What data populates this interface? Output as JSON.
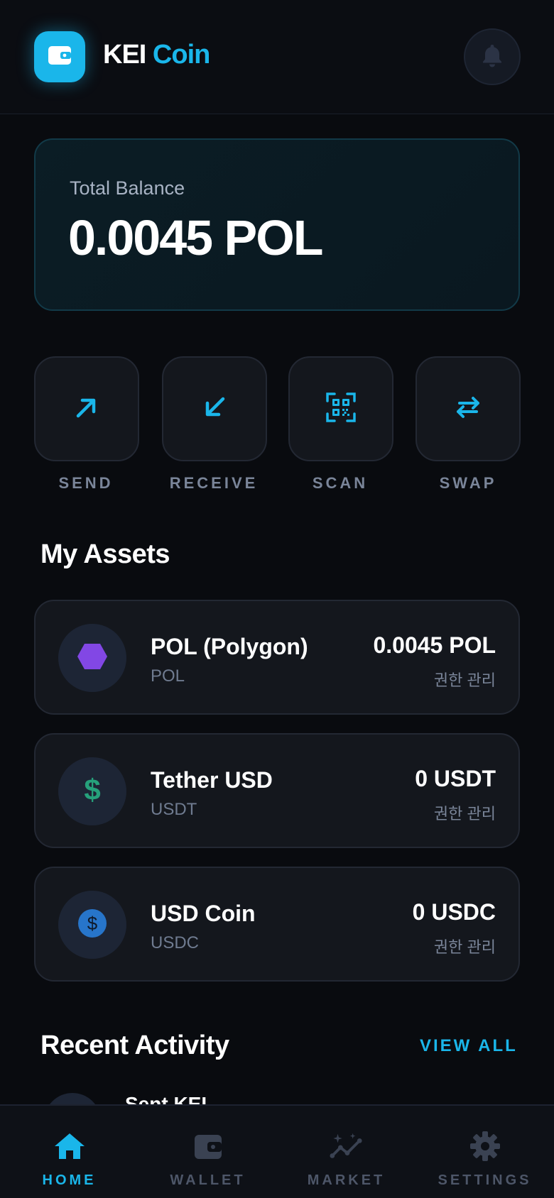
{
  "header": {
    "brand_primary": "KEI",
    "brand_accent": "Coin",
    "logo_icon": "wallet-icon",
    "notification_icon": "bell-icon"
  },
  "balance": {
    "label": "Total Balance",
    "value": "0.0045 POL"
  },
  "actions": [
    {
      "label": "SEND",
      "icon": "arrow-up-right-icon"
    },
    {
      "label": "RECEIVE",
      "icon": "arrow-down-left-icon"
    },
    {
      "label": "SCAN",
      "icon": "qr-scan-icon"
    },
    {
      "label": "SWAP",
      "icon": "swap-arrows-icon"
    }
  ],
  "assets": {
    "title": "My Assets",
    "items": [
      {
        "name": "POL (Polygon)",
        "symbol": "POL",
        "amount": "0.0045 POL",
        "sub": "권한 관리",
        "icon": "polygon-hexagon-icon"
      },
      {
        "name": "Tether USD",
        "symbol": "USDT",
        "amount": "0 USDT",
        "sub": "권한 관리",
        "icon": "dollar-sign-icon"
      },
      {
        "name": "USD Coin",
        "symbol": "USDC",
        "amount": "0 USDC",
        "sub": "권한 관리",
        "icon": "dollar-circle-icon"
      }
    ]
  },
  "activity": {
    "title": "Recent Activity",
    "view_all": "VIEW ALL",
    "items": [
      {
        "title": "Sent KEI"
      }
    ]
  },
  "nav": [
    {
      "label": "HOME",
      "icon": "home-icon",
      "active": true
    },
    {
      "label": "WALLET",
      "icon": "wallet-icon",
      "active": false
    },
    {
      "label": "MARKET",
      "icon": "market-trend-icon",
      "active": false
    },
    {
      "label": "SETTINGS",
      "icon": "gear-icon",
      "active": false
    }
  ],
  "colors": {
    "accent": "#1ab6ea",
    "background": "#090b0f",
    "card": "#14171d",
    "polygon": "#8247e5",
    "tether": "#26a17b",
    "usdc": "#2775ca"
  }
}
